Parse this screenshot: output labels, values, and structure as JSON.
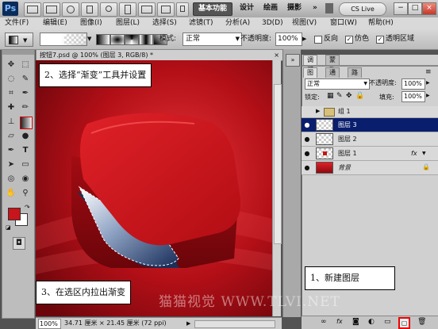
{
  "app": {
    "logo": "Ps"
  },
  "workspace": {
    "tabs": [
      "基本功能",
      "设计",
      "绘画",
      "摄影"
    ],
    "more": "»",
    "cs_live": "CS Live"
  },
  "window_controls": [
    "−",
    "□",
    "×"
  ],
  "menu": [
    "文件(F)",
    "编辑(E)",
    "图像(I)",
    "图层(L)",
    "选择(S)",
    "滤镜(T)",
    "分析(A)",
    "3D(D)",
    "视图(V)",
    "窗口(W)",
    "帮助(H)"
  ],
  "options": {
    "mode_label": "模式:",
    "mode_value": "正常",
    "opacity_label": "不透明度:",
    "opacity_value": "100%",
    "reverse": "反向",
    "dither": "仿色",
    "transparency": "透明区域"
  },
  "document": {
    "tab_title": "按钮7.psd @ 100% (图层 3, RGB/8) *",
    "zoom": "100%",
    "doc_info": "34.71 厘米 × 21.45 厘米 (72 ppi)"
  },
  "layers_panel": {
    "tabs_top": [
      "调整",
      "蒙版"
    ],
    "tabs": [
      "图层",
      "通道",
      "路径"
    ],
    "blend_mode": "正常",
    "opacity_label": "不透明度:",
    "opacity_value": "100%",
    "lock_label": "锁定:",
    "fill_label": "填充:",
    "fill_value": "100%",
    "layers": [
      {
        "name": "组 1",
        "type": "group",
        "visible": false,
        "selected": false
      },
      {
        "name": "图层 3",
        "type": "transparent",
        "visible": true,
        "selected": true
      },
      {
        "name": "图层 2",
        "type": "transparent",
        "visible": true,
        "selected": false
      },
      {
        "name": "图层 1",
        "type": "red-dot",
        "visible": true,
        "selected": false,
        "fx": "fx"
      },
      {
        "name": "背景",
        "type": "background",
        "visible": true,
        "selected": false
      }
    ],
    "footer_icons": [
      "link-icon",
      "fx-icon",
      "mask-icon",
      "adjustment-icon",
      "folder-icon",
      "new-layer-icon",
      "trash-icon"
    ]
  },
  "callouts": {
    "step1": "1、新建图层",
    "step2": "2、选择“渐变”工具并设置",
    "step3": "3、在选区内拉出渐变"
  },
  "watermark": "猫猫视觉 WWW.TLVI.NET",
  "colors": {
    "red": "#c8141b",
    "dark_red": "#8d0a10",
    "navy": "#1a2f5a",
    "selection_blue": "#0a1e6e"
  }
}
